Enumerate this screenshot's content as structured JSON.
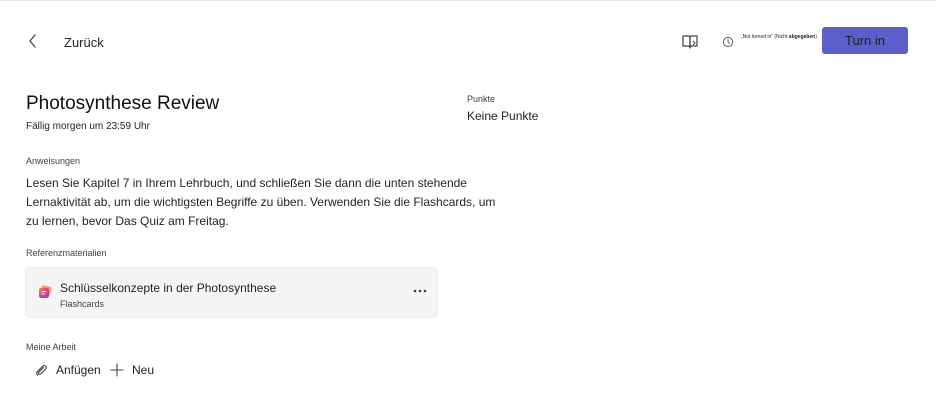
{
  "header": {
    "back_label": "Zurück",
    "status_prefix": "„Not turned in“ (Nicht",
    "status_bold": "abgegeben",
    "status_suffix": ")",
    "turn_in_label": "Turn in"
  },
  "assignment": {
    "title": "Photosynthese Review",
    "due": "Fällig morgen um 23:59 Uhr",
    "points_label": "Punkte",
    "points_value": "Keine Punkte",
    "instructions_label": "Anweisungen",
    "instructions_text": "Lesen Sie Kapitel 7 in Ihrem Lehrbuch, und schließen Sie dann die unten stehende Lernaktivität ab, um die wichtigsten Begriffe zu üben. Verwenden Sie die Flashcards, um zu lernen, bevor Das Quiz am Freitag."
  },
  "reference": {
    "label": "Referenzmaterialien",
    "items": [
      {
        "title": "Schlüsselkonzepte in der Photosynthese",
        "type": "Flashcards"
      }
    ]
  },
  "my_work": {
    "label": "Meine Arbeit",
    "attach_label": "Anfügen",
    "new_label": "Neu"
  },
  "icons": {
    "back": "chevron-left-icon",
    "reader": "immersive-reader-icon",
    "status": "clock-icon",
    "reference_item": "flashcards-app-icon",
    "more": "more-options-icon",
    "attach": "paperclip-icon",
    "new": "plus-icon"
  },
  "colors": {
    "accent": "#5b5fc7",
    "card_background": "#f5f5f5"
  }
}
